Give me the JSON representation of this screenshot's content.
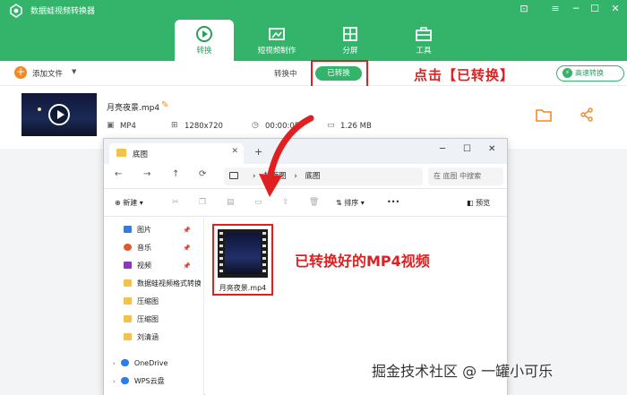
{
  "app": {
    "title": "数据蛙视频转换器",
    "window_controls": [
      "⊡",
      "─",
      "☐",
      "✕"
    ]
  },
  "tabs": [
    {
      "label": "转换",
      "icon": "convert-icon",
      "active": true
    },
    {
      "label": "短视频制作",
      "icon": "video-maker-icon",
      "active": false
    },
    {
      "label": "分屏",
      "icon": "split-screen-icon",
      "active": false
    },
    {
      "label": "工具",
      "icon": "toolbox-icon",
      "active": false
    }
  ],
  "toolbar": {
    "add_label": "添加文件",
    "segment_converting": "转换中",
    "segment_converted": "已转换",
    "speed_label": "高速转换"
  },
  "annotations": {
    "click_converted": "点击【已转换】",
    "converted_mp4": "已转换好的MP4视频"
  },
  "file": {
    "name": "月亮夜景.mp4",
    "format": "MP4",
    "resolution": "1280x720",
    "duration": "00:00:05",
    "size": "1.26 MB"
  },
  "explorer": {
    "tab_title": "底图",
    "path_part1": "封面图",
    "path_sep": "›",
    "path_part2": "底图",
    "search_placeholder": "在 底图 中搜索",
    "cmd_new": "新建",
    "cmd_sort": "排序",
    "cmd_more": "•••",
    "cmd_preview": "预览",
    "sidebar": [
      {
        "label": "图片",
        "color": "#3a7bd5",
        "pinned": true
      },
      {
        "label": "音乐",
        "color": "#e05a2b",
        "pinned": true
      },
      {
        "label": "视频",
        "color": "#8a3ab9",
        "pinned": true
      },
      {
        "label": "数据蛙视频格式转换",
        "color": "#f2c14e",
        "pinned": false
      },
      {
        "label": "压缩图",
        "color": "#f2c14e",
        "pinned": false
      },
      {
        "label": "压缩图",
        "color": "#f2c14e",
        "pinned": false
      },
      {
        "label": "刘清涵",
        "color": "#f2c14e",
        "pinned": false
      },
      {
        "label": "OneDrive",
        "color": "#2b7de9",
        "pinned": false
      },
      {
        "label": "WPS云盘",
        "color": "#2b7de9",
        "pinned": false
      }
    ],
    "file_item": {
      "label": "月亮夜景.mp4"
    }
  },
  "watermark": "掘金技术社区 @ 一罐小可乐",
  "colors": {
    "brand_green": "#34b36b",
    "accent_orange": "#f08a24",
    "annotation_red": "#e02020"
  }
}
